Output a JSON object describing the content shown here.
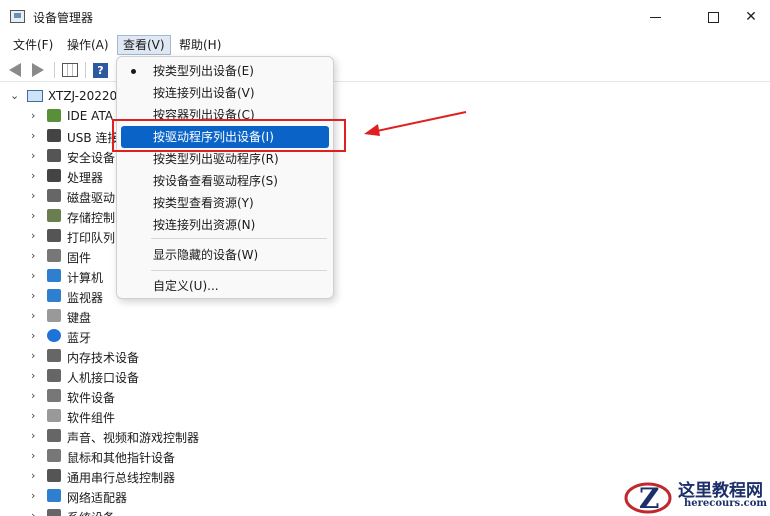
{
  "window": {
    "title": "设备管理器"
  },
  "menubar": {
    "items": [
      "文件(F)",
      "操作(A)",
      "查看(V)",
      "帮助(H)"
    ],
    "active": "查看(V)"
  },
  "tree": {
    "root": "XTZJ-20220",
    "items": [
      {
        "label": "IDE ATA",
        "icon": "ide-controller-icon"
      },
      {
        "label": "USB 连接",
        "icon": "usb-icon"
      },
      {
        "label": "安全设备",
        "icon": "security-device-icon"
      },
      {
        "label": "处理器",
        "icon": "processor-icon"
      },
      {
        "label": "磁盘驱动",
        "icon": "disk-drive-icon"
      },
      {
        "label": "存储控制",
        "icon": "storage-controller-icon"
      },
      {
        "label": "打印队列",
        "icon": "printer-icon"
      },
      {
        "label": "固件",
        "icon": "firmware-icon"
      },
      {
        "label": "计算机",
        "icon": "computer-icon"
      },
      {
        "label": "监视器",
        "icon": "monitor-icon"
      },
      {
        "label": "键盘",
        "icon": "keyboard-icon"
      },
      {
        "label": "蓝牙",
        "icon": "bluetooth-icon"
      },
      {
        "label": "内存技术设备",
        "icon": "memory-icon"
      },
      {
        "label": "人机接口设备",
        "icon": "hid-icon"
      },
      {
        "label": "软件设备",
        "icon": "software-device-icon"
      },
      {
        "label": "软件组件",
        "icon": "software-component-icon"
      },
      {
        "label": "声音、视频和游戏控制器",
        "icon": "sound-icon"
      },
      {
        "label": "鼠标和其他指针设备",
        "icon": "mouse-icon"
      },
      {
        "label": "通用串行总线控制器",
        "icon": "usb-controller-icon"
      },
      {
        "label": "网络适配器",
        "icon": "network-adapter-icon"
      },
      {
        "label": "系统设备",
        "icon": "system-device-icon"
      }
    ]
  },
  "view_menu": {
    "items": [
      {
        "label": "按类型列出设备(E)",
        "checked": true
      },
      {
        "label": "按连接列出设备(V)"
      },
      {
        "label": "按容器列出设备(C)"
      },
      {
        "label": "按驱动程序列出设备(I)",
        "highlighted": true
      },
      {
        "label": "按类型列出驱动程序(R)"
      },
      {
        "label": "按设备查看驱动程序(S)"
      },
      {
        "label": "按类型查看资源(Y)"
      },
      {
        "label": "按连接列出资源(N)"
      },
      {
        "label": "显示隐藏的设备(W)"
      },
      {
        "label": "自定义(U)..."
      }
    ]
  },
  "watermark": {
    "title": "这里教程网",
    "url": "herecours.com"
  },
  "colors": {
    "highlight": "#0a64c8",
    "annotation": "#e02020"
  }
}
